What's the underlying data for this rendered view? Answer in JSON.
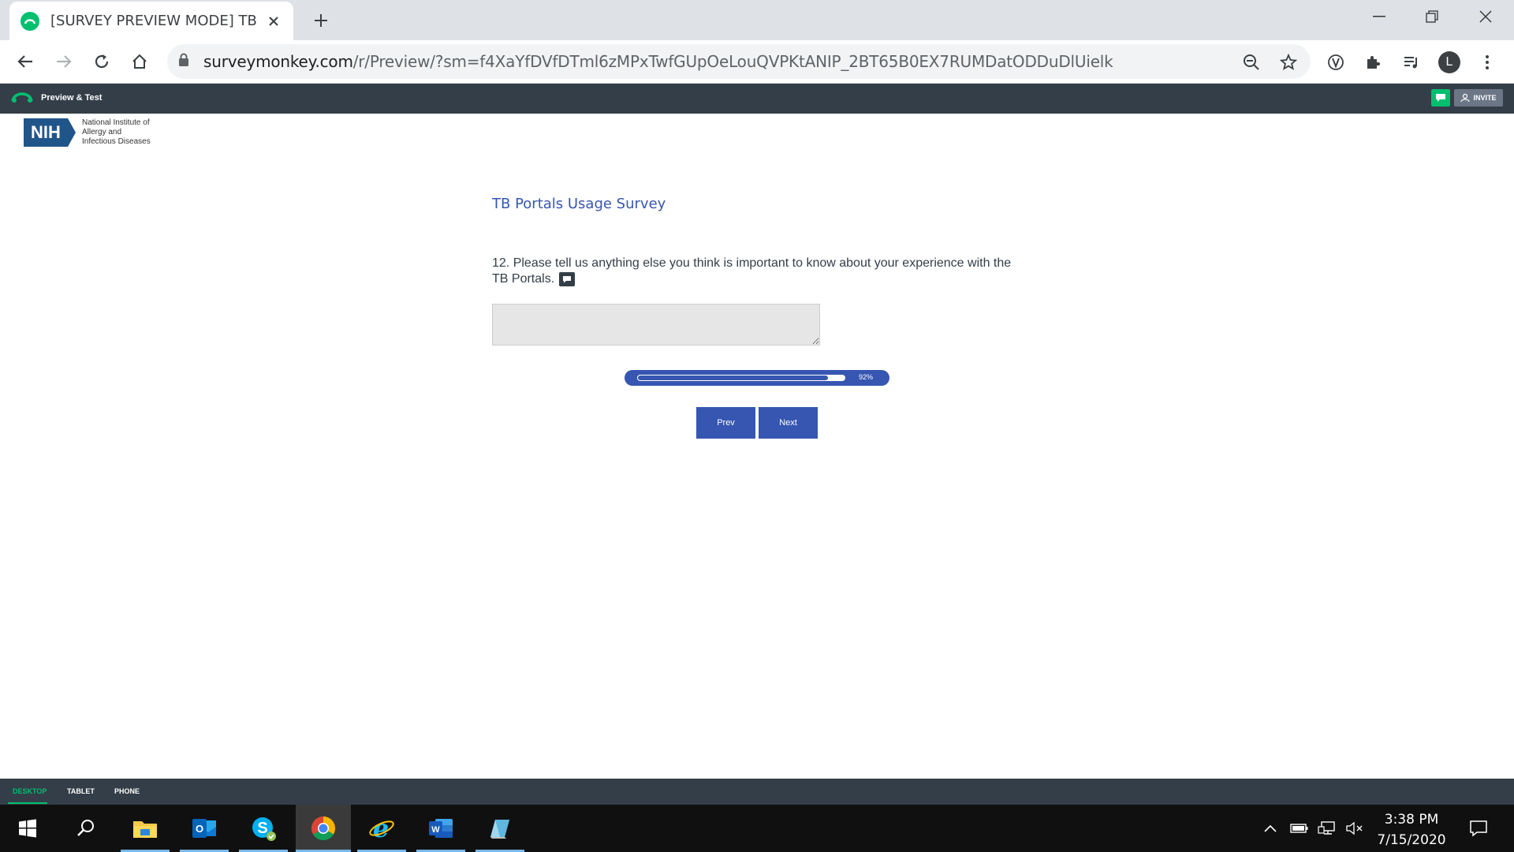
{
  "browser": {
    "tab_title": "[SURVEY PREVIEW MODE] TB Por",
    "url_host": "surveymonkey.com",
    "url_path": "/r/Preview/?sm=f4XaYfDVfDTml6zMPxTwfGUpOeLouQVPKtANIP_2BT65B0EX7RUMDatODDuDlUielk",
    "profile_initial": "L"
  },
  "sm_header": {
    "mode_label": "Preview & Test",
    "invite_label": "INVITE"
  },
  "logo": {
    "abbr": "NIH",
    "line1": "National Institute of",
    "line2": "Allergy and",
    "line3": "Infectious Diseases"
  },
  "survey": {
    "title": "TB Portals Usage Survey",
    "question": "12. Please tell us anything else you think is important to know about your experience with the TB Portals.",
    "answer_value": "",
    "progress_percent": 92,
    "progress_label": "92%",
    "prev_label": "Prev",
    "next_label": "Next"
  },
  "device_bar": {
    "desktop": "DESKTOP",
    "tablet": "TABLET",
    "phone": "PHONE"
  },
  "taskbar": {
    "time": "3:38 PM",
    "date": "7/15/2020"
  },
  "colors": {
    "accent": "#3656b1",
    "brand_green": "#00bf6f",
    "header_dark": "#333e48"
  }
}
